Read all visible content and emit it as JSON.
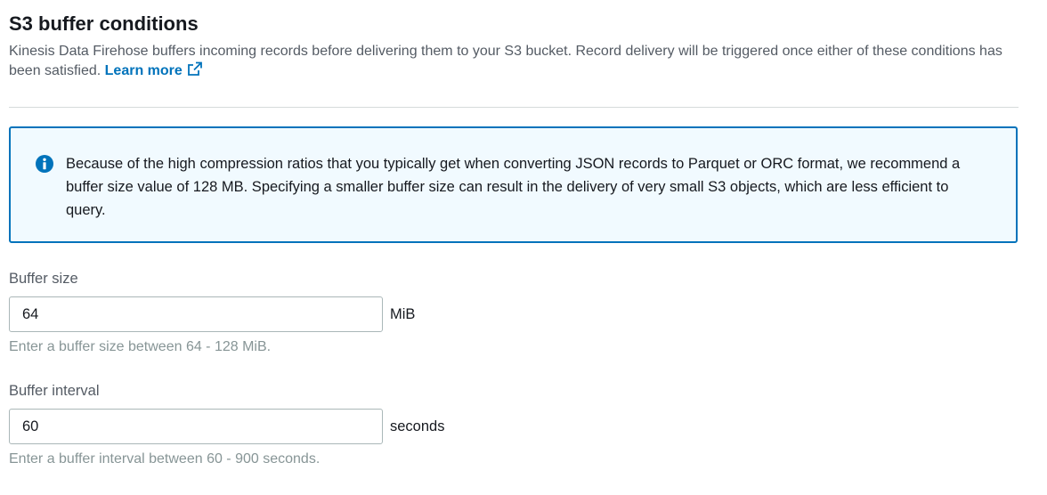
{
  "section": {
    "title": "S3 buffer conditions",
    "description": "Kinesis Data Firehose buffers incoming records before delivering them to your S3 bucket. Record delivery will be triggered once either of these conditions has been satisfied.",
    "learn_more": "Learn more"
  },
  "info_alert": {
    "icon": "info-icon",
    "text": "Because of the high compression ratios that you typically get when converting JSON records to Parquet or ORC format, we recommend a buffer size value of 128 MB. Specifying a smaller buffer size can result in the delivery of very small S3 objects, which are less efficient to query."
  },
  "buffer_size": {
    "label": "Buffer size",
    "value": "64",
    "unit": "MiB",
    "hint": "Enter a buffer size between 64 - 128 MiB."
  },
  "buffer_interval": {
    "label": "Buffer interval",
    "value": "60",
    "unit": "seconds",
    "hint": "Enter a buffer interval between 60 - 900 seconds."
  },
  "colors": {
    "link": "#0073bb",
    "info_border": "#0073bb",
    "info_background": "#f1faff",
    "hint_text": "#879596"
  }
}
